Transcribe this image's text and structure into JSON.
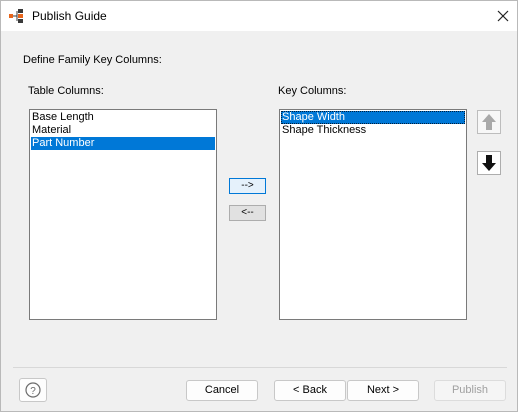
{
  "window": {
    "title": "Publish Guide",
    "app_icon": "family-table-icon",
    "close_icon": "close-icon"
  },
  "dialog": {
    "heading": "Define Family Key Columns:",
    "table_columns": {
      "label": "Table Columns:",
      "items": [
        {
          "label": "Base Length",
          "selected": false
        },
        {
          "label": "Material",
          "selected": false
        },
        {
          "label": "Part Number",
          "selected": true
        }
      ]
    },
    "key_columns": {
      "label": "Key Columns:",
      "items": [
        {
          "label": "Shape Width",
          "selected": true
        },
        {
          "label": "Shape Thickness",
          "selected": false
        }
      ]
    },
    "add_button_label": "-->",
    "remove_button_label": "<--",
    "move_up_icon": "arrow-up-icon",
    "move_down_icon": "arrow-down-icon"
  },
  "footer": {
    "help_icon": "help-icon",
    "cancel_label": "Cancel",
    "back_label": "< Back",
    "next_label": "Next >",
    "publish_label": "Publish"
  }
}
